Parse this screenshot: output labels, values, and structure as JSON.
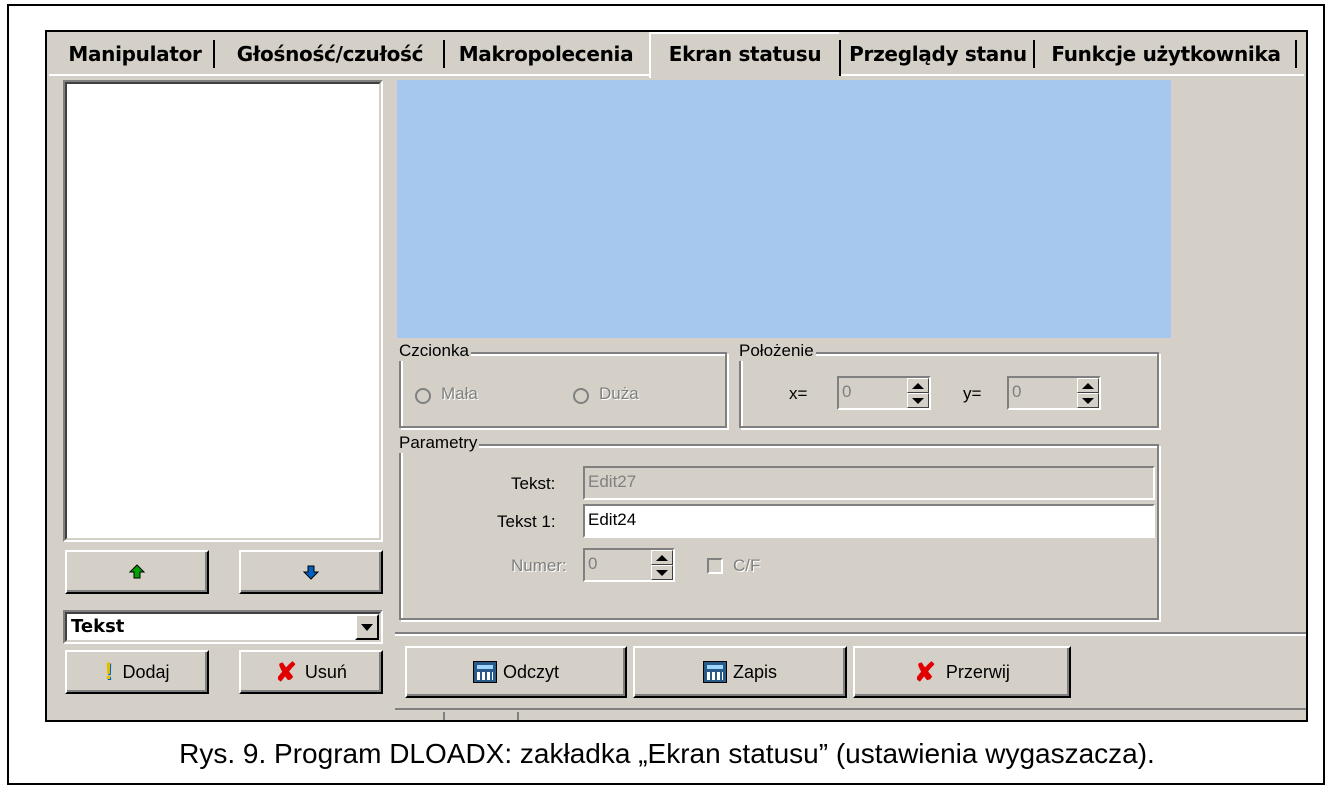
{
  "tabs": [
    "Manipulator",
    "Głośność/czułość",
    "Makropolecenia",
    "Ekran statusu",
    "Przeglądy stanu",
    "Funkcje użytkownika"
  ],
  "active_tab": "Ekran statusu",
  "czcionka": {
    "label": "Czcionka",
    "option_small": "Mała",
    "option_large": "Duża"
  },
  "polozenie": {
    "label": "Położenie",
    "x_label": "x=",
    "x_value": "0",
    "y_label": "y=",
    "y_value": "0"
  },
  "parametry": {
    "label": "Parametry",
    "tekst_label": "Tekst:",
    "tekst_value": "Edit27",
    "tekst1_label": "Tekst 1:",
    "tekst1_value": "Edit24",
    "numer_label": "Numer:",
    "numer_value": "0",
    "cf_label": "C/F"
  },
  "left": {
    "combo_value": "Tekst",
    "add_label": "Dodaj",
    "remove_label": "Usuń"
  },
  "bottom_buttons": {
    "read": "Odczyt",
    "write": "Zapis",
    "abort": "Przerwij"
  },
  "colors": {
    "preview": "#a6c8ee",
    "face": "#d4d0c8",
    "red_x": "#e00000",
    "green_arrow": "#00a000",
    "blue_arrow": "#0060c0"
  },
  "caption": "Rys. 9. Program DLOADX: zakładka „Ekran statusu” (ustawienia wygaszacza)."
}
